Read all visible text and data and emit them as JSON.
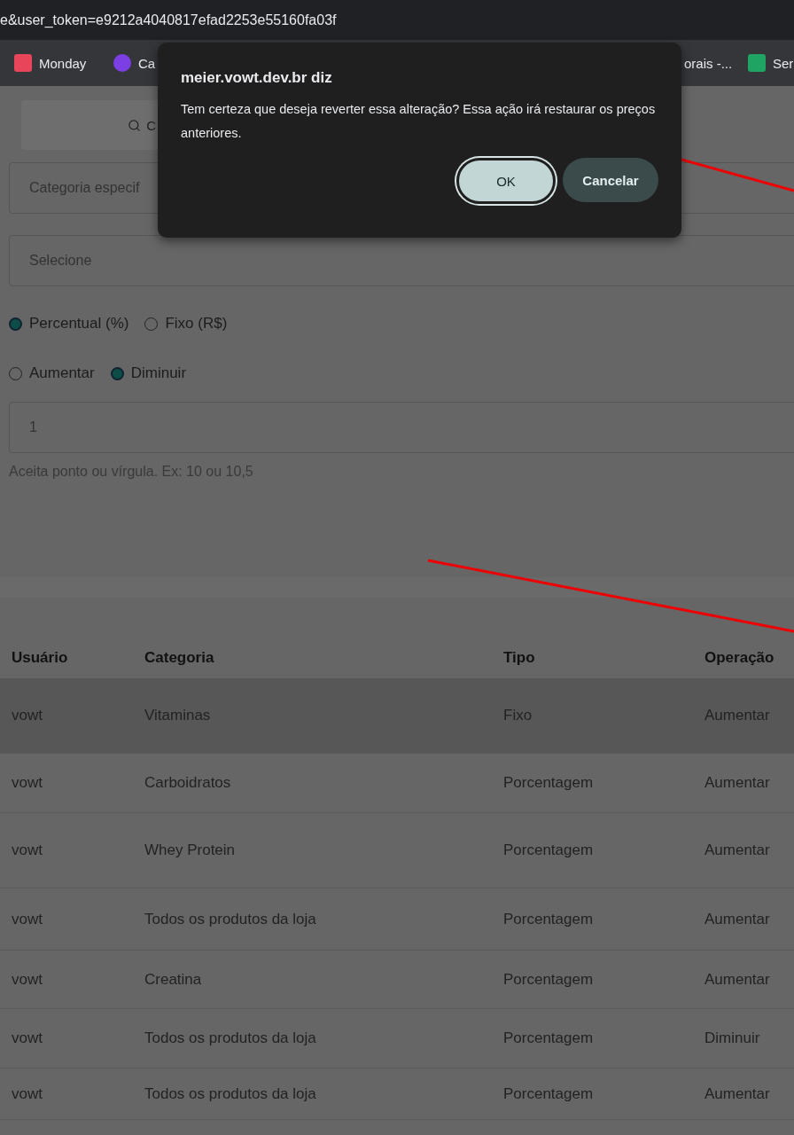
{
  "address_bar": {
    "url": "e&user_token=e9212a4040817efad2253e55160fa03f"
  },
  "bookmarks": [
    {
      "label": "Monday",
      "color": "#e8445a"
    },
    {
      "label": "Ca",
      "color": "#7b3fe4"
    },
    {
      "label": "orais -..."
    },
    {
      "label": "Ser",
      "color": "#1fa463"
    }
  ],
  "search_button": {
    "label": "C"
  },
  "category_field": {
    "placeholder": "Categoria especif"
  },
  "select_field": {
    "value": "Selecione"
  },
  "value_type": [
    {
      "label": "Percentual (%)",
      "selected": true
    },
    {
      "label": "Fixo (R$)",
      "selected": false
    }
  ],
  "operation": [
    {
      "label": "Aumentar",
      "selected": false
    },
    {
      "label": "Diminuir",
      "selected": true
    }
  ],
  "amount_field": {
    "value": "1",
    "hint": "Aceita ponto ou vírgula. Ex: 10 ou 10,5"
  },
  "table": {
    "columns": [
      "Usuário",
      "Categoria",
      "Tipo",
      "Operação"
    ],
    "rows": [
      {
        "cells": [
          "vowt",
          "Vitaminas",
          "Fixo",
          "Aumentar"
        ],
        "highlighted": true
      },
      {
        "cells": [
          "vowt",
          "Carboidratos",
          "Porcentagem",
          "Aumentar"
        ],
        "highlighted": false
      },
      {
        "cells": [
          "vowt",
          "Whey Protein",
          "Porcentagem",
          "Aumentar"
        ],
        "highlighted": false
      },
      {
        "cells": [
          "vowt",
          "Todos os produtos da loja",
          "Porcentagem",
          "Aumentar"
        ],
        "highlighted": false
      },
      {
        "cells": [
          "vowt",
          "Creatina",
          "Porcentagem",
          "Aumentar"
        ],
        "highlighted": false
      },
      {
        "cells": [
          "vowt",
          "Todos os produtos da loja",
          "Porcentagem",
          "Diminuir"
        ],
        "highlighted": false
      },
      {
        "cells": [
          "vowt",
          "Todos os produtos da loja",
          "Porcentagem",
          "Aumentar"
        ],
        "highlighted": false
      }
    ]
  },
  "dialog": {
    "title": "meier.vowt.dev.br diz",
    "message": "Tem certeza que deseja reverter essa alteração? Essa ação irá restaurar os preços anteriores.",
    "buttons": [
      {
        "label": "OK",
        "kind": "primary"
      },
      {
        "label": "Cancelar",
        "kind": "secondary"
      }
    ]
  }
}
